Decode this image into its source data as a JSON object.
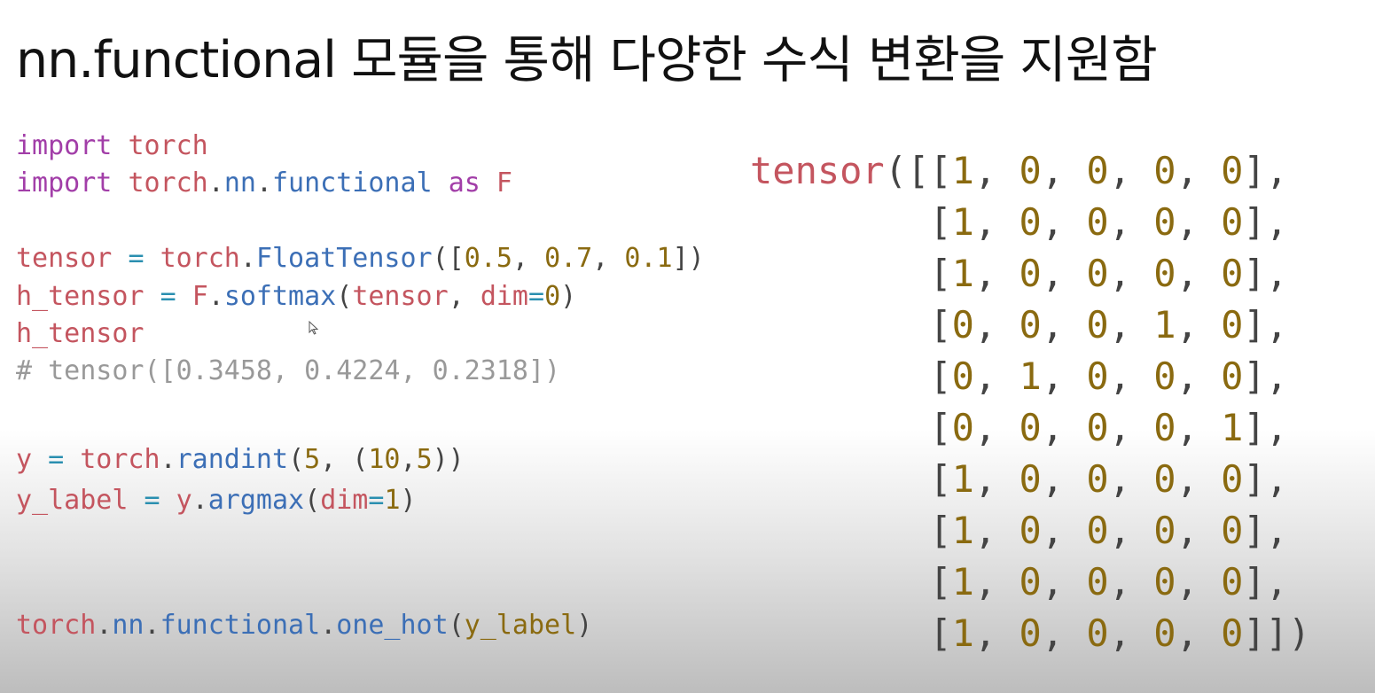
{
  "slide": {
    "title": "nn.functional 모듈을 통해 다양한 수식 변환을 지원함"
  },
  "code": {
    "line1": {
      "kw": "import",
      "mod": "torch"
    },
    "line2": {
      "kw": "import",
      "mod1": "torch",
      "mod2": "nn",
      "mod3": "functional",
      "as": "as",
      "alias": "F"
    },
    "line4": {
      "lhs": "tensor",
      "eq": "=",
      "obj": "torch",
      "fn": "FloatTensor",
      "open": "([",
      "v1": "0.5",
      "v2": "0.7",
      "v3": "0.1",
      "close": "])"
    },
    "line5": {
      "lhs": "h_tensor",
      "eq": "=",
      "obj": "F",
      "fn": "softmax",
      "arg": "tensor",
      "kwarg": "dim",
      "val": "0"
    },
    "line6": {
      "text": "h_tensor"
    },
    "line7": {
      "comment": "# tensor([0.3458, 0.4224, 0.2318])"
    },
    "line9": {
      "lhs": "y",
      "eq": "=",
      "obj": "torch",
      "fn": "randint",
      "a1": "5",
      "a2": "10",
      "a3": "5"
    },
    "line10": {
      "lhs": "y_label",
      "eq": "=",
      "obj": "y",
      "fn": "argmax",
      "kwarg": "dim",
      "val": "1"
    },
    "line13": {
      "obj": "torch",
      "mod1": "nn",
      "mod2": "functional",
      "fn": "one_hot",
      "arg": "y_label"
    }
  },
  "output": {
    "prefix": "tensor",
    "rows": [
      [
        "1",
        "0",
        "0",
        "0",
        "0"
      ],
      [
        "1",
        "0",
        "0",
        "0",
        "0"
      ],
      [
        "1",
        "0",
        "0",
        "0",
        "0"
      ],
      [
        "0",
        "0",
        "0",
        "1",
        "0"
      ],
      [
        "0",
        "1",
        "0",
        "0",
        "0"
      ],
      [
        "0",
        "0",
        "0",
        "0",
        "1"
      ],
      [
        "1",
        "0",
        "0",
        "0",
        "0"
      ],
      [
        "1",
        "0",
        "0",
        "0",
        "0"
      ],
      [
        "1",
        "0",
        "0",
        "0",
        "0"
      ],
      [
        "1",
        "0",
        "0",
        "0",
        "0"
      ]
    ]
  },
  "colors": {
    "keyword": "#a23ea8",
    "variable": "#c4555f",
    "function": "#3c6fb6",
    "number": "#8a6a10",
    "operator": "#2a8fb0",
    "comment": "#999999"
  },
  "icons": {
    "cursor": "mouse-pointer-icon"
  }
}
